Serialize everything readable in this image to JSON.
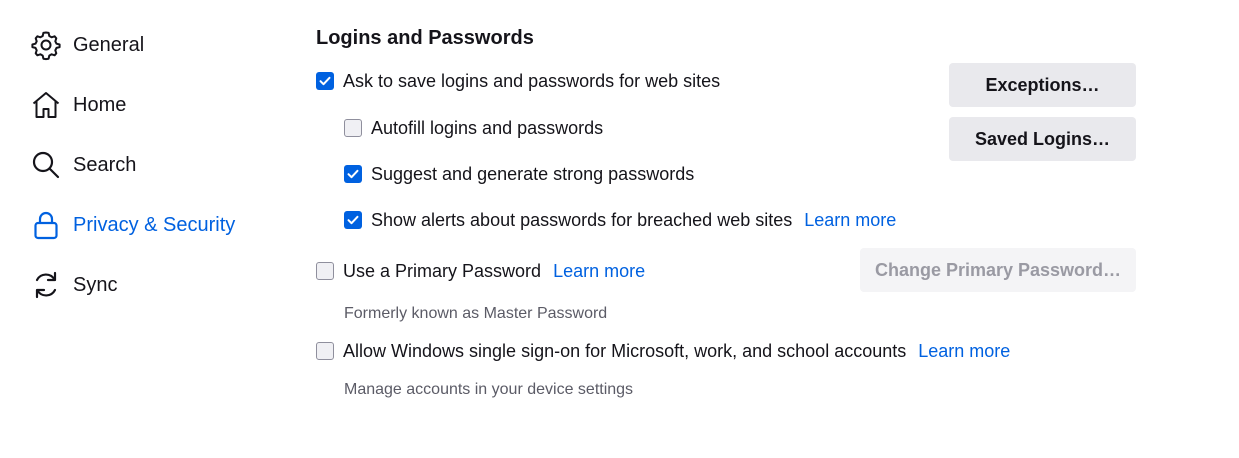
{
  "sidebar": {
    "items": [
      {
        "label": "General",
        "icon": "gear-icon",
        "active": false
      },
      {
        "label": "Home",
        "icon": "home-icon",
        "active": false
      },
      {
        "label": "Search",
        "icon": "search-icon",
        "active": false
      },
      {
        "label": "Privacy & Security",
        "icon": "lock-icon",
        "active": true
      },
      {
        "label": "Sync",
        "icon": "sync-icon",
        "active": false
      }
    ]
  },
  "logins": {
    "title": "Logins and Passwords",
    "ask_to_save": {
      "label": "Ask to save logins and passwords for web sites",
      "checked": true
    },
    "autofill": {
      "label": "Autofill logins and passwords",
      "checked": false
    },
    "suggest": {
      "label": "Suggest and generate strong passwords",
      "checked": true
    },
    "breach_alerts": {
      "label": "Show alerts about passwords for breached web sites",
      "checked": true,
      "link": "Learn more"
    },
    "primary_password": {
      "label": "Use a Primary Password",
      "checked": false,
      "link": "Learn more",
      "hint": "Formerly known as Master Password"
    },
    "windows_sso": {
      "label": "Allow Windows single sign-on for Microsoft, work, and school accounts",
      "checked": false,
      "link": "Learn more",
      "hint": "Manage accounts in your device settings"
    },
    "buttons": {
      "exceptions": "Exceptions…",
      "saved_logins": "Saved Logins…",
      "change_primary": "Change Primary Password…"
    }
  },
  "colors": {
    "accent": "#0061e0",
    "text": "#15141a",
    "muted": "#5b5b66",
    "button_bg": "#e9e9ed"
  }
}
